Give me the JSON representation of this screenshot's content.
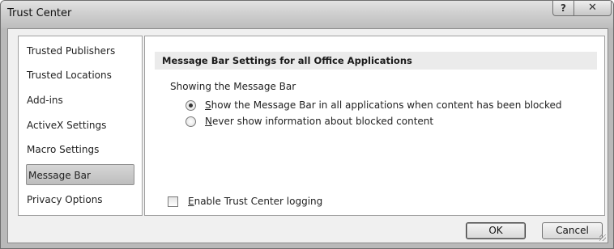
{
  "window": {
    "title": "Trust Center",
    "help_label": "?",
    "close_label": "✕"
  },
  "sidebar": {
    "items": [
      {
        "label": "Trusted Publishers"
      },
      {
        "label": "Trusted Locations"
      },
      {
        "label": "Add-ins"
      },
      {
        "label": "ActiveX Settings"
      },
      {
        "label": "Macro Settings"
      },
      {
        "label": "Message Bar",
        "selected": true
      },
      {
        "label": "Privacy Options"
      }
    ]
  },
  "main": {
    "section_title": "Message Bar Settings for all Office Applications",
    "group_label": "Showing the Message Bar",
    "options": [
      {
        "accel": "S",
        "rest": "how the Message Bar in all applications when content has been blocked",
        "checked": true
      },
      {
        "accel": "N",
        "rest": "ever show information about blocked content",
        "checked": false
      }
    ],
    "logging": {
      "accel": "E",
      "rest": "nable Trust Center logging",
      "checked": false
    }
  },
  "footer": {
    "ok_label": "OK",
    "cancel_label": "Cancel"
  }
}
